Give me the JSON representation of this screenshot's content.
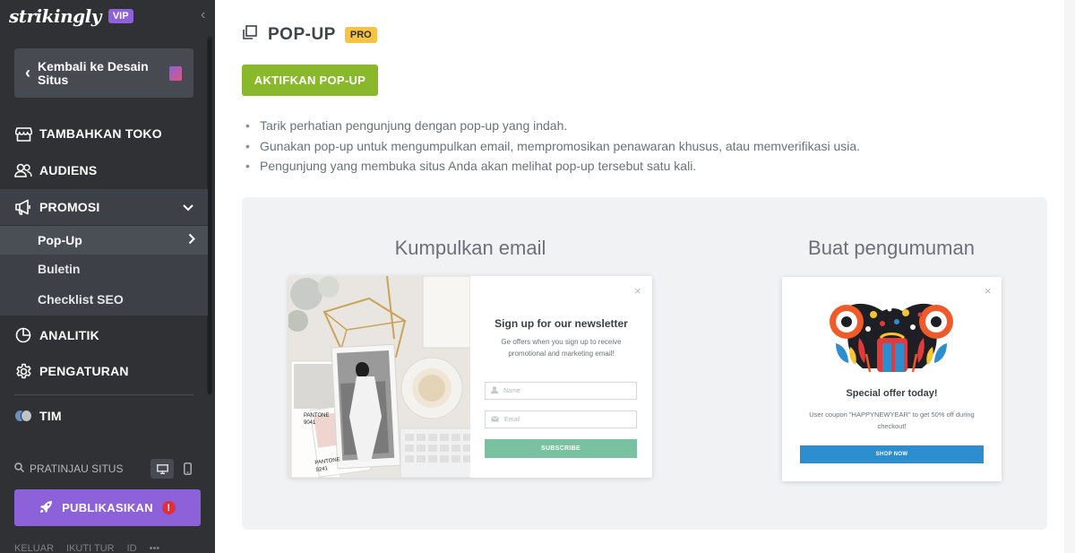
{
  "brand": {
    "logo": "strikingly",
    "badge": "VIP"
  },
  "sidebar": {
    "back_label": "Kembali ke Desain Situs",
    "items": [
      {
        "label": "TAMBAHKAN TOKO",
        "icon": "store-icon"
      },
      {
        "label": "AUDIENS",
        "icon": "users-icon"
      },
      {
        "label": "PROMOSI",
        "icon": "megaphone-icon"
      },
      {
        "label": "ANALITIK",
        "icon": "pie-chart-icon"
      },
      {
        "label": "PENGATURAN",
        "icon": "gear-icon"
      },
      {
        "label": "TIM",
        "icon": "team-avatars-icon"
      }
    ],
    "subitems": [
      {
        "label": "Pop-Up",
        "active": true
      },
      {
        "label": "Buletin"
      },
      {
        "label": "Checklist SEO"
      }
    ],
    "preview_label": "PRATINJAU SITUS",
    "publish_label": "PUBLIKASIKAN",
    "publish_warning": "!",
    "footer": [
      "KELUAR",
      "IKUTI TUR",
      "ID",
      "•••"
    ]
  },
  "main": {
    "title": "POP-UP",
    "pro_badge": "PRO",
    "activate_label": "AKTIFKAN POP-UP",
    "bullets": [
      "Tarik perhatian pengunjung dengan pop-up yang indah.",
      "Gunakan pop-up untuk mengumpulkan email, mempromosikan penawaran khusus, atau memverifikasi usia.",
      "Pengunjung yang membuka situs Anda akan melihat pop-up tersebut satu kali."
    ],
    "examples": {
      "email_title": "Kumpulkan email",
      "announce_title": "Buat pengumuman",
      "newsletter": {
        "title": "Sign up for our newsletter",
        "desc": "Ge offers when you sign up to receive promotional and marketing email!",
        "name_placeholder": "Name",
        "email_placeholder": "Email",
        "button": "SUBSCRIBE",
        "pantone_1": "PANTONE\n9041",
        "pantone_2": "PANTONE\n9241"
      },
      "offer": {
        "title": "Special offer today!",
        "desc": "User coupon \"HAPPYNEWYEAR\" to get 50% off during checkout!",
        "button": "SHOP NOW"
      },
      "close_glyph": "×"
    }
  },
  "colors": {
    "sidebar_bg": "#2f3134",
    "accent_purple": "#8c61d9",
    "activate_green": "#89b92a",
    "pro_yellow": "#f6c343",
    "subscribe_green": "#79c1a0",
    "shop_blue": "#2d8ecf"
  }
}
